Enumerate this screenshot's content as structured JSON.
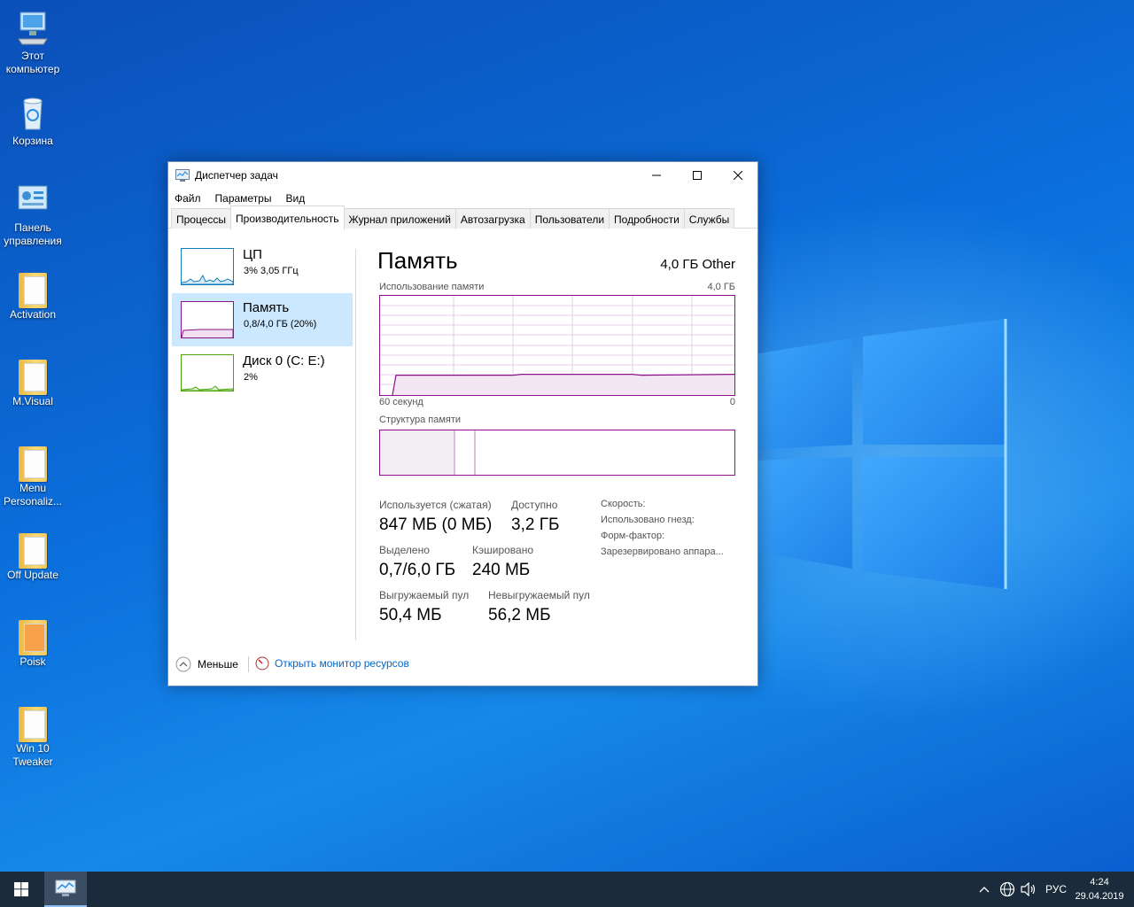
{
  "desktop": {
    "icons": [
      {
        "label": "Этот компьютер",
        "icon": "computer-icon"
      },
      {
        "label": "Корзина",
        "icon": "recycle-bin-icon"
      },
      {
        "label": "Панель управления",
        "icon": "control-panel-icon"
      },
      {
        "label": "Activation",
        "icon": "folder-icon"
      },
      {
        "label": "M.Visual",
        "icon": "folder-icon"
      },
      {
        "label": "Menu Personaliz...",
        "icon": "folder-icon"
      },
      {
        "label": "Off Update",
        "icon": "folder-icon"
      },
      {
        "label": "Poisk",
        "icon": "folder-icon"
      },
      {
        "label": "Win 10 Tweaker",
        "icon": "folder-icon"
      }
    ]
  },
  "window": {
    "title": "Диспетчер задач",
    "menu": [
      "Файл",
      "Параметры",
      "Вид"
    ],
    "tabs": [
      "Процессы",
      "Производительность",
      "Журнал приложений",
      "Автозагрузка",
      "Пользователи",
      "Подробности",
      "Службы"
    ],
    "active_tab": "Производительность",
    "sidebar": [
      {
        "name": "ЦП",
        "sub": "3%  3,05 ГГц",
        "color": "#117dbb"
      },
      {
        "name": "Память",
        "sub": "0,8/4,0 ГБ (20%)",
        "color": "#8b128b"
      },
      {
        "name": "Диск 0 (C: E:)",
        "sub": "2%",
        "color": "#4da60c"
      }
    ],
    "memory": {
      "title": "Память",
      "total": "4,0 ГБ Other",
      "usage_label": "Использование памяти",
      "usage_max": "4,0 ГБ",
      "time_left": "60 секунд",
      "time_right": "0",
      "structure_label": "Структура памяти",
      "usage_fraction": 0.2,
      "stats": {
        "in_use_label": "Используется (сжатая)",
        "in_use_value": "847 МБ (0 МБ)",
        "available_label": "Доступно",
        "available_value": "3,2 ГБ",
        "committed_label": "Выделено",
        "committed_value": "0,7/6,0 ГБ",
        "cached_label": "Кэшировано",
        "cached_value": "240 МБ",
        "paged_label": "Выгружаемый пул",
        "paged_value": "50,4 МБ",
        "nonpaged_label": "Невыгружаемый пул",
        "nonpaged_value": "56,2 МБ"
      },
      "specs": [
        "Скорость:",
        "Использовано гнезд:",
        "Форм-фактор:",
        "Зарезервировано аппара..."
      ]
    },
    "footer": {
      "less": "Меньше",
      "monitor": "Открыть монитор ресурсов"
    }
  },
  "taskbar": {
    "language": "РУС",
    "time": "4:24",
    "date": "29.04.2019"
  },
  "colors": {
    "memory_accent": "#8b128b",
    "cpu_accent": "#117dbb",
    "disk_accent": "#4da60c",
    "selection": "#cce8ff",
    "link": "#0066cc"
  }
}
